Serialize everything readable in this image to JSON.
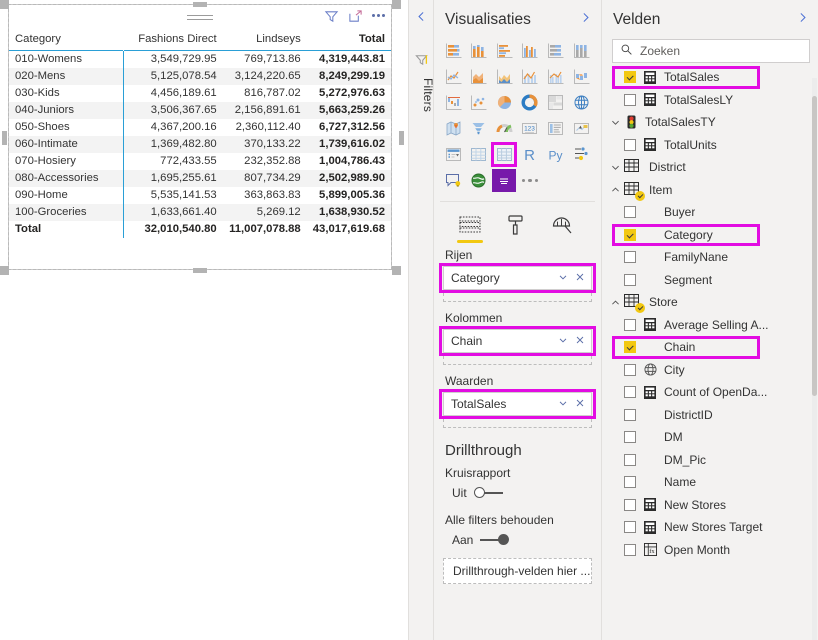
{
  "visual": {
    "header_icons": [
      "filter-icon",
      "focus-mode-icon",
      "more-options-icon"
    ],
    "columns": [
      "Category",
      "Fashions Direct",
      "Lindseys",
      "Total"
    ],
    "rows": [
      {
        "category": "010-Womens",
        "fashions_direct": "3,549,729.95",
        "lindseys": "769,713.86",
        "total": "4,319,443.81"
      },
      {
        "category": "020-Mens",
        "fashions_direct": "5,125,078.54",
        "lindseys": "3,124,220.65",
        "total": "8,249,299.19"
      },
      {
        "category": "030-Kids",
        "fashions_direct": "4,456,189.61",
        "lindseys": "816,787.02",
        "total": "5,272,976.63"
      },
      {
        "category": "040-Juniors",
        "fashions_direct": "3,506,367.65",
        "lindseys": "2,156,891.61",
        "total": "5,663,259.26"
      },
      {
        "category": "050-Shoes",
        "fashions_direct": "4,367,200.16",
        "lindseys": "2,360,112.40",
        "total": "6,727,312.56"
      },
      {
        "category": "060-Intimate",
        "fashions_direct": "1,369,482.80",
        "lindseys": "370,133.22",
        "total": "1,739,616.02"
      },
      {
        "category": "070-Hosiery",
        "fashions_direct": "772,433.55",
        "lindseys": "232,352.88",
        "total": "1,004,786.43"
      },
      {
        "category": "080-Accessories",
        "fashions_direct": "1,695,255.61",
        "lindseys": "807,734.29",
        "total": "2,502,989.90"
      },
      {
        "category": "090-Home",
        "fashions_direct": "5,535,141.53",
        "lindseys": "363,863.83",
        "total": "5,899,005.36"
      },
      {
        "category": "100-Groceries",
        "fashions_direct": "1,633,661.40",
        "lindseys": "5,269.12",
        "total": "1,638,930.52"
      }
    ],
    "total_row": {
      "category": "Total",
      "fashions_direct": "32,010,540.80",
      "lindseys": "11,007,078.88",
      "total": "43,017,619.68"
    }
  },
  "filters_rail": {
    "label": "Filters",
    "collapse_icon": "chevron-left-icon",
    "filter_icon": "filter-icon"
  },
  "viz_pane": {
    "title": "Visualisaties",
    "expand_icon": "chevron-right-icon",
    "gallery": [
      "stacked-bar-chart-icon",
      "stacked-column-chart-icon",
      "clustered-bar-chart-icon",
      "clustered-column-chart-icon",
      "hundred-percent-stacked-bar-chart-icon",
      "hundred-percent-stacked-column-chart-icon",
      "line-chart-icon",
      "area-chart-icon",
      "stacked-area-chart-icon",
      "line-and-stacked-column-chart-icon",
      "line-and-clustered-column-chart-icon",
      "ribbon-chart-icon",
      "waterfall-chart-icon",
      "scatter-chart-icon",
      "pie-chart-icon",
      "donut-chart-icon",
      "treemap-icon",
      "map-icon",
      "filled-map-icon",
      "funnel-icon",
      "gauge-icon",
      "card-icon",
      "multi-row-card-icon",
      "kpi-icon",
      "slicer-icon",
      "table-icon",
      "matrix-icon",
      "r-script-visual-icon",
      "python-visual-icon",
      "key-influencers-icon",
      "q-and-a-icon",
      "arcgis-map-icon",
      "paginated-report-icon"
    ],
    "selected_visual": "matrix-icon",
    "more_visuals_icon": "ellipsis-icon",
    "tabs": [
      {
        "name": "fields-tab",
        "icon": "fields-icon",
        "active": true
      },
      {
        "name": "format-tab",
        "icon": "paint-roller-icon",
        "active": false
      },
      {
        "name": "analytics-tab",
        "icon": "analytics-magnifier-icon",
        "active": false
      }
    ],
    "wells": [
      {
        "label": "Rijen",
        "field": "Category",
        "highlighted": true
      },
      {
        "label": "Kolommen",
        "field": "Chain",
        "highlighted": true
      },
      {
        "label": "Waarden",
        "field": "TotalSales",
        "highlighted": true
      }
    ],
    "well_icons": [
      "chevron-down-icon",
      "remove-field-icon"
    ],
    "drillthrough": {
      "title": "Drillthrough",
      "cross_report_label": "Kruisrapport",
      "cross_report_state": "Uit",
      "cross_report_on": false,
      "keep_filters_label": "Alle filters behouden",
      "keep_filters_state": "Aan",
      "keep_filters_on": true,
      "drop_placeholder": "Drillthrough-velden hier ..."
    }
  },
  "fields_pane": {
    "title": "Velden",
    "expand_icon": "chevron-right-icon",
    "search_placeholder": "Zoeken",
    "search_icon": "search-icon",
    "items": [
      {
        "name": "TotalSales",
        "indent": 1,
        "checkbox": true,
        "checked": true,
        "type_icon": "measure-icon",
        "chevron": "none",
        "highlighted": true
      },
      {
        "name": "TotalSalesLY",
        "indent": 1,
        "checkbox": true,
        "checked": false,
        "type_icon": "measure-icon",
        "chevron": "none",
        "highlighted": false
      },
      {
        "name": "TotalSalesTY",
        "indent": 0,
        "checkbox": false,
        "checked": false,
        "type_icon": "kpi-traffic-light-icon",
        "chevron": "down",
        "highlighted": false
      },
      {
        "name": "TotalUnits",
        "indent": 1,
        "checkbox": true,
        "checked": false,
        "type_icon": "measure-icon",
        "chevron": "none",
        "highlighted": false
      },
      {
        "name": "District",
        "indent": 0,
        "checkbox": false,
        "checked": false,
        "type_icon": "table-icon",
        "chevron": "down",
        "highlighted": false
      },
      {
        "name": "Item",
        "indent": 0,
        "checkbox": false,
        "checked": true,
        "type_icon": "table-checked-icon",
        "chevron": "up",
        "highlighted": false
      },
      {
        "name": "Buyer",
        "indent": 1,
        "checkbox": true,
        "checked": false,
        "type_icon": "none",
        "chevron": "none",
        "highlighted": false
      },
      {
        "name": "Category",
        "indent": 1,
        "checkbox": true,
        "checked": true,
        "type_icon": "none",
        "chevron": "none",
        "highlighted": true
      },
      {
        "name": "FamilyNane",
        "indent": 1,
        "checkbox": true,
        "checked": false,
        "type_icon": "none",
        "chevron": "none",
        "highlighted": false
      },
      {
        "name": "Segment",
        "indent": 1,
        "checkbox": true,
        "checked": false,
        "type_icon": "none",
        "chevron": "none",
        "highlighted": false
      },
      {
        "name": "Store",
        "indent": 0,
        "checkbox": false,
        "checked": true,
        "type_icon": "table-checked-icon",
        "chevron": "up",
        "highlighted": false
      },
      {
        "name": "Average Selling A...",
        "indent": 1,
        "checkbox": true,
        "checked": false,
        "type_icon": "measure-icon",
        "chevron": "none",
        "highlighted": false
      },
      {
        "name": "Chain",
        "indent": 1,
        "checkbox": true,
        "checked": true,
        "type_icon": "none",
        "chevron": "none",
        "highlighted": true
      },
      {
        "name": "City",
        "indent": 1,
        "checkbox": true,
        "checked": false,
        "type_icon": "geo-globe-icon",
        "chevron": "none",
        "highlighted": false
      },
      {
        "name": "Count of OpenDa...",
        "indent": 1,
        "checkbox": true,
        "checked": false,
        "type_icon": "measure-icon",
        "chevron": "none",
        "highlighted": false
      },
      {
        "name": "DistrictID",
        "indent": 1,
        "checkbox": true,
        "checked": false,
        "type_icon": "none",
        "chevron": "none",
        "highlighted": false
      },
      {
        "name": "DM",
        "indent": 1,
        "checkbox": true,
        "checked": false,
        "type_icon": "none",
        "chevron": "none",
        "highlighted": false
      },
      {
        "name": "DM_Pic",
        "indent": 1,
        "checkbox": true,
        "checked": false,
        "type_icon": "none",
        "chevron": "none",
        "highlighted": false
      },
      {
        "name": "Name",
        "indent": 1,
        "checkbox": true,
        "checked": false,
        "type_icon": "none",
        "chevron": "none",
        "highlighted": false
      },
      {
        "name": "New Stores",
        "indent": 1,
        "checkbox": true,
        "checked": false,
        "type_icon": "measure-icon",
        "chevron": "none",
        "highlighted": false
      },
      {
        "name": "New Stores Target",
        "indent": 1,
        "checkbox": true,
        "checked": false,
        "type_icon": "measure-icon",
        "chevron": "none",
        "highlighted": false
      },
      {
        "name": "Open Month",
        "indent": 1,
        "checkbox": true,
        "checked": false,
        "type_icon": "calculated-column-icon",
        "chevron": "none",
        "highlighted": false
      }
    ]
  },
  "colors": {
    "highlight_magenta": "#e20ce2",
    "checkbox_yellow": "#f2c811",
    "pane_background": "#f3f2f1",
    "matrix_accent": "#2a9fd6",
    "selected_visual_purple": "#7719aa"
  }
}
